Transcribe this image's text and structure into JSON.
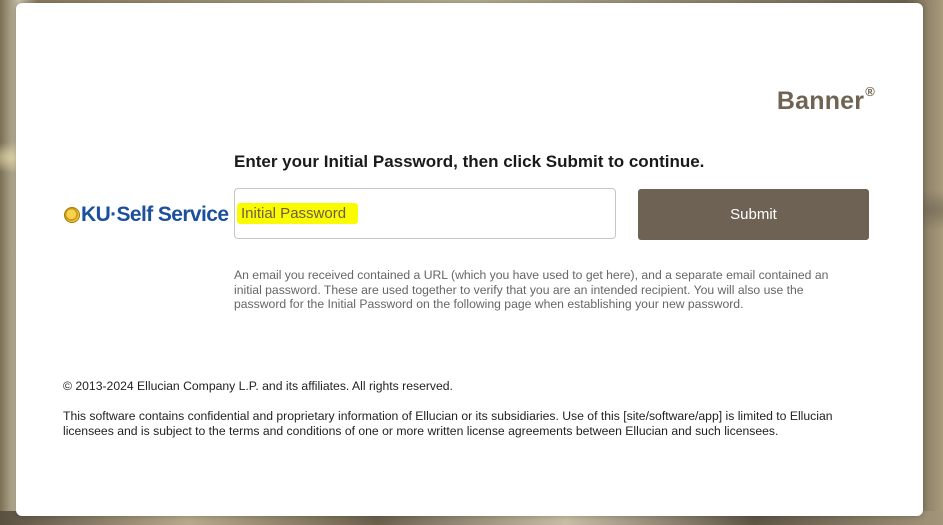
{
  "brand": {
    "name": "Banner",
    "mark": "®"
  },
  "logo": {
    "text": "KU·Self Service",
    "icon": "seal-icon"
  },
  "form": {
    "instruction": "Enter your Initial Password, then click Submit to continue.",
    "password_placeholder": "Initial Password",
    "submit_label": "Submit"
  },
  "help_text": "An email you received contained a URL (which you have used to get here), and a separate email contained an initial password. These are used together to verify that you are an intended recipient. You will also use the password for the Initial Password on the following page when establishing your new password.",
  "footer": {
    "copyright": "© 2013-2024 Ellucian Company L.P. and its affiliates. All rights reserved.",
    "legal": "This software contains confidential and proprietary information of Ellucian or its subsidiaries. Use of this [site/software/app] is limited to Ellucian licensees and is subject to the terms and conditions of one or more written license agreements between Ellucian and such licensees."
  },
  "colors": {
    "accent": "#6e6254",
    "logo_blue": "#1c4f9c",
    "highlight": "#fbfb00"
  }
}
